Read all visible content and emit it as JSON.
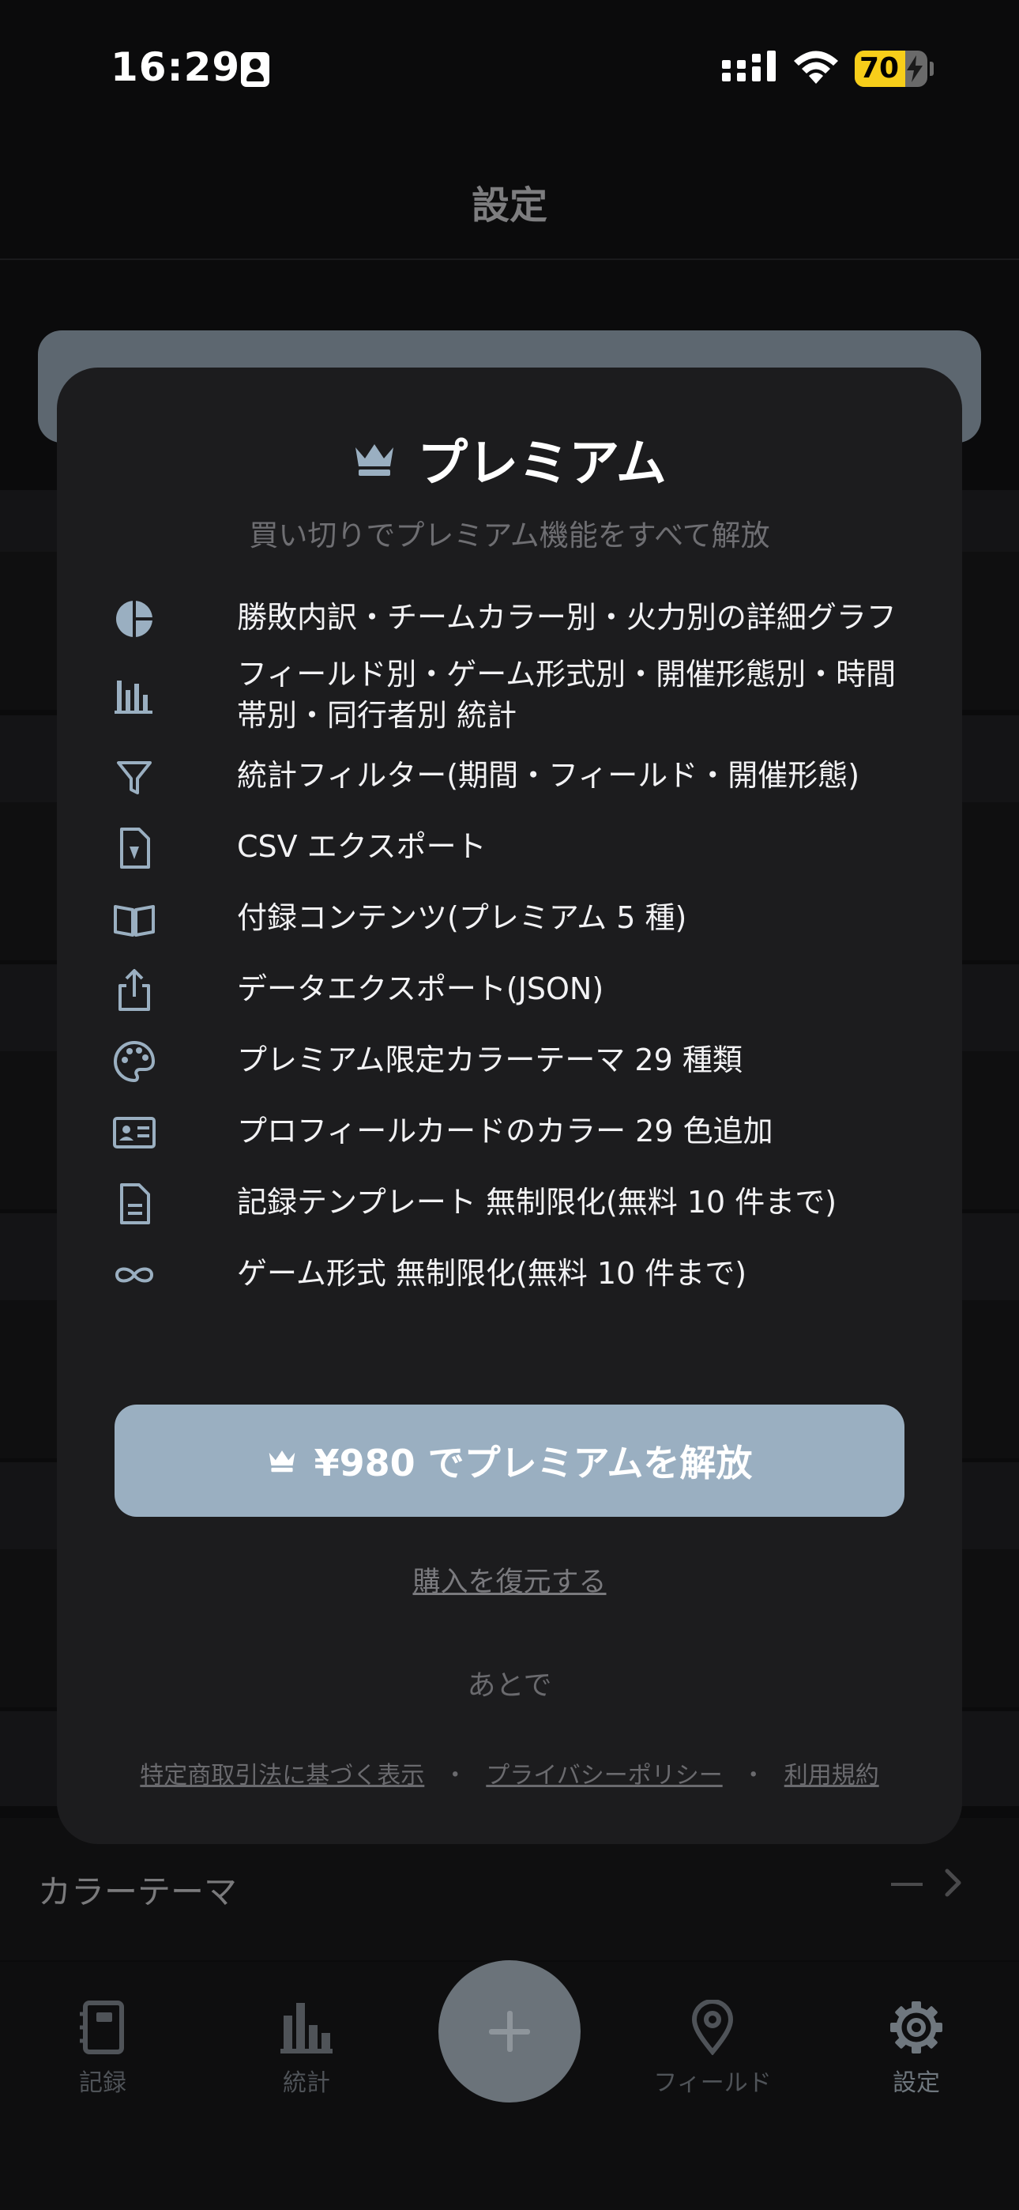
{
  "status_bar": {
    "time": "16:29",
    "battery_level": "70",
    "battery_percent": 70,
    "colors": {
      "battery": "#f7ce1a"
    }
  },
  "header": {
    "title": "設定"
  },
  "background_rows": {
    "color_theme_label": "カラーテーマ",
    "color_theme_value": "—"
  },
  "modal": {
    "title": "プレミアム",
    "subtitle": "買い切りでプレミアム機能をすべて解放",
    "features": [
      {
        "icon": "pie-chart-icon",
        "text": "勝敗内訳・チームカラー別・火力別の詳細グラフ"
      },
      {
        "icon": "bar-chart-icon",
        "text": "フィールド別・ゲーム形式別・開催形態別・時間帯別・同行者別 統計"
      },
      {
        "icon": "filter-icon",
        "text": "統計フィルター(期間・フィールド・開催形態)"
      },
      {
        "icon": "csv-file-icon",
        "text": "CSV エクスポート"
      },
      {
        "icon": "open-book-icon",
        "text": "付録コンテンツ(プレミアム 5 種)"
      },
      {
        "icon": "share-export-icon",
        "text": "データエクスポート(JSON)"
      },
      {
        "icon": "palette-icon",
        "text": "プレミアム限定カラーテーマ 29 種類"
      },
      {
        "icon": "id-card-icon",
        "text": "プロフィールカードのカラー 29 色追加"
      },
      {
        "icon": "document-icon",
        "text": "記録テンプレート 無制限化(無料 10 件まで)"
      },
      {
        "icon": "infinity-icon",
        "text": "ゲーム形式 無制限化(無料 10 件まで)"
      }
    ],
    "buy_button": "¥980 でプレミアムを解放",
    "restore_link": "購入を復元する",
    "later_button": "あとで",
    "legal_links": [
      "特定商取引法に基づく表示",
      "プライバシーポリシー",
      "利用規約"
    ],
    "legal_separator": "・",
    "colors": {
      "accent": "#9aafc1",
      "card": "#1c1c1e"
    }
  },
  "tabbar": {
    "tabs": [
      {
        "id": "record",
        "label": "記録",
        "icon": "notebook-icon"
      },
      {
        "id": "stats",
        "label": "統計",
        "icon": "bar-chart-icon"
      },
      {
        "id": "field",
        "label": "フィールド",
        "icon": "map-pin-icon"
      },
      {
        "id": "settings",
        "label": "設定",
        "icon": "gear-icon",
        "active": true
      }
    ],
    "fab_icon": "plus-icon"
  }
}
